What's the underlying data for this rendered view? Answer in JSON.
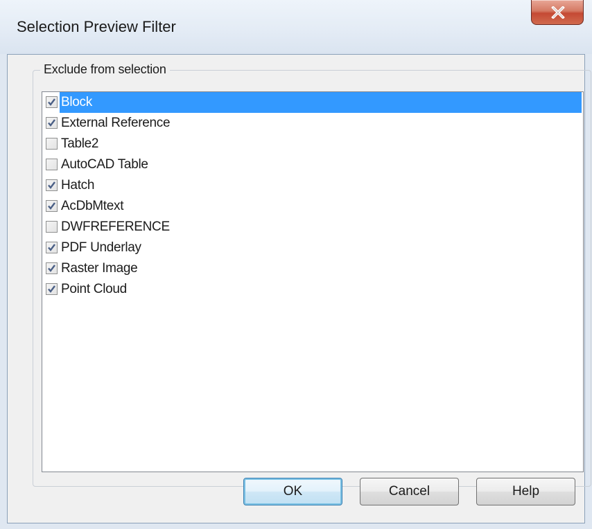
{
  "window": {
    "title": "Selection Preview Filter",
    "close_icon": "close-icon"
  },
  "group": {
    "label": "Exclude from selection"
  },
  "items": [
    {
      "label": "Block",
      "checked": true,
      "selected": true
    },
    {
      "label": "External Reference",
      "checked": true,
      "selected": false
    },
    {
      "label": "Table2",
      "checked": false,
      "selected": false
    },
    {
      "label": "AutoCAD Table",
      "checked": false,
      "selected": false
    },
    {
      "label": "Hatch",
      "checked": true,
      "selected": false
    },
    {
      "label": "AcDbMtext",
      "checked": true,
      "selected": false
    },
    {
      "label": "DWFREFERENCE",
      "checked": false,
      "selected": false
    },
    {
      "label": "PDF Underlay",
      "checked": true,
      "selected": false
    },
    {
      "label": "Raster Image",
      "checked": true,
      "selected": false
    },
    {
      "label": "Point Cloud",
      "checked": true,
      "selected": false
    }
  ],
  "buttons": {
    "ok": "OK",
    "cancel": "Cancel",
    "help": "Help"
  },
  "colors": {
    "selection": "#3399ff",
    "checkmark": "#4a5f86",
    "close_button": "#c54a34"
  }
}
